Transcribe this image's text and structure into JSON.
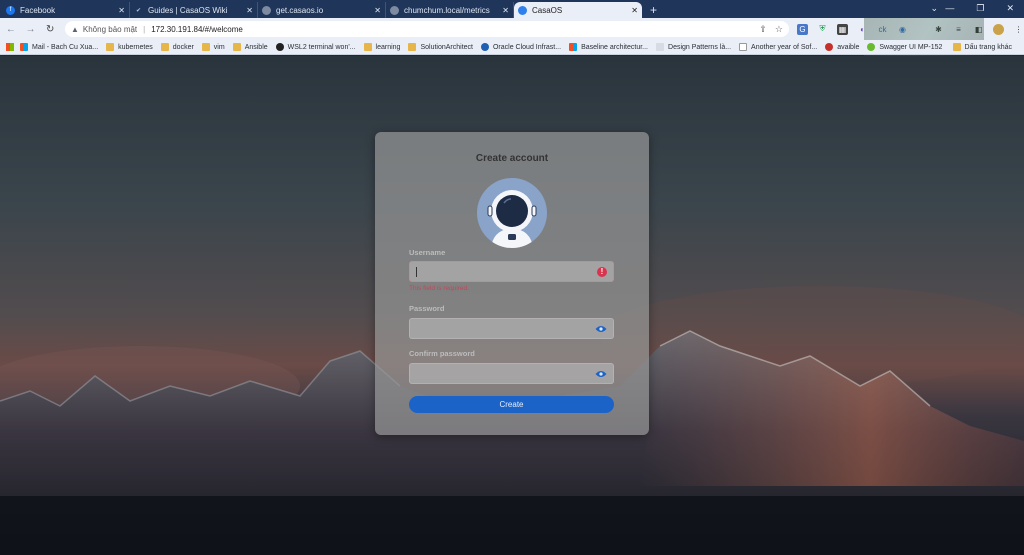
{
  "browser": {
    "tabs": [
      {
        "title": "Facebook",
        "icon": "facebook-icon",
        "color": "#1877f2"
      },
      {
        "title": "Guides | CasaOS Wiki",
        "icon": "checkmark-icon",
        "color": "#3b7ddd"
      },
      {
        "title": "get.casaos.io",
        "icon": "globe-icon",
        "color": "#7d8aa0"
      },
      {
        "title": "chumchum.local/metrics",
        "icon": "globe-icon",
        "color": "#7d8aa0"
      },
      {
        "title": "CasaOS",
        "icon": "casaos-icon",
        "color": "#2f80ed",
        "active": true
      }
    ],
    "new_tab": "+",
    "address": {
      "security_text": "Không bảo mật",
      "separator": "|",
      "url": "172.30.191.84/#/welcome"
    },
    "bookmarks": [
      {
        "label": "Mail - Bach Cu Xua...",
        "icon": "microsoft-icon"
      },
      {
        "label": "kubernetes",
        "icon": "folder-icon"
      },
      {
        "label": "docker",
        "icon": "folder-icon"
      },
      {
        "label": "vim",
        "icon": "folder-icon"
      },
      {
        "label": "Ansible",
        "icon": "folder-icon"
      },
      {
        "label": "WSL2 terminal won'...",
        "icon": "github-icon"
      },
      {
        "label": "learning",
        "icon": "folder-icon"
      },
      {
        "label": "SolutionArchitect",
        "icon": "folder-icon"
      },
      {
        "label": "Oracle Cloud Infrast...",
        "icon": "oracle-icon"
      },
      {
        "label": "Baseline architectur...",
        "icon": "windows-icon"
      },
      {
        "label": "Design Patterns là...",
        "icon": "page-icon"
      },
      {
        "label": "Another year of Sof...",
        "icon": "page-icon"
      },
      {
        "label": "avaible",
        "icon": "oracle-icon"
      },
      {
        "label": "Swagger UI MP-152",
        "icon": "swagger-icon"
      }
    ],
    "bookmarks_other": "Dấu trang khác"
  },
  "form": {
    "title": "Create account",
    "username": {
      "label": "Username",
      "value": "",
      "error": "This field is required."
    },
    "password": {
      "label": "Password",
      "value": ""
    },
    "confirm": {
      "label": "Confirm password",
      "value": ""
    },
    "submit": "Create"
  }
}
